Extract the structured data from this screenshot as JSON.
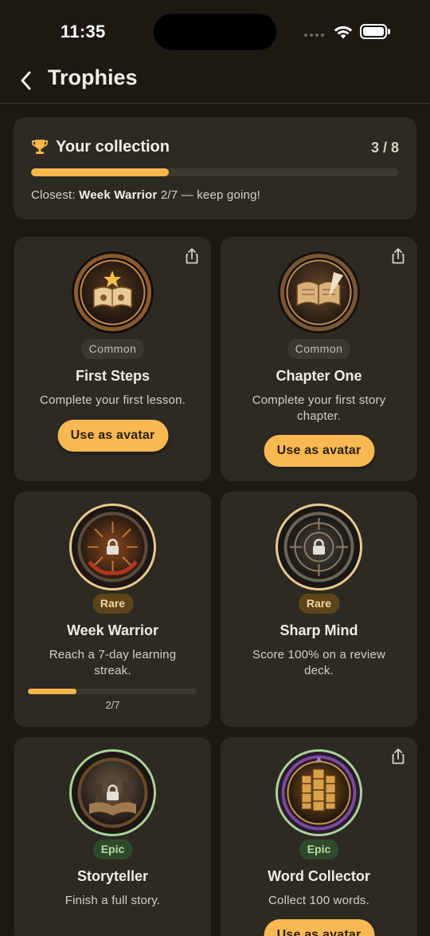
{
  "status_bar": {
    "time": "11:35"
  },
  "header": {
    "title": "Trophies"
  },
  "summary": {
    "title": "Your collection",
    "count": "3 / 8",
    "progress": 0.375,
    "hint_prefix": "Closest:",
    "hint_name": "Week Warrior",
    "hint_suffix": "2/7 — keep going!"
  },
  "trophies": [
    {
      "rarity": "Common",
      "title": "First Steps",
      "description": "Complete your first lesson.",
      "button": "Use as avatar",
      "unlocked": true
    },
    {
      "rarity": "Common",
      "title": "Chapter One",
      "description": "Complete your first story chapter.",
      "button": "Use as avatar",
      "unlocked": true
    },
    {
      "rarity": "Rare",
      "title": "Week Warrior",
      "description": "Reach a 7-day learning streak.",
      "progress_label": "2/7",
      "progress": 0.2857,
      "unlocked": false
    },
    {
      "rarity": "Rare",
      "title": "Sharp Mind",
      "description": "Score 100% on a review deck.",
      "unlocked": false
    },
    {
      "rarity": "Epic",
      "title": "Storyteller",
      "description": "Finish a full story.",
      "unlocked": false
    },
    {
      "rarity": "Epic",
      "title": "Word Collector",
      "description": "Collect 100 words.",
      "button": "Use as avatar",
      "unlocked": true
    }
  ],
  "colors": {
    "background": "#1c1913",
    "card": "#2d2a23",
    "accent": "#f5b64a",
    "rare_badge": "#5e4518",
    "epic_badge": "#2f4a2b"
  }
}
